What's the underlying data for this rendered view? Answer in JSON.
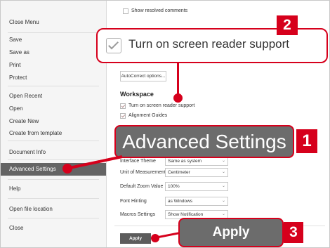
{
  "menu": {
    "items": [
      {
        "label": "Close Menu"
      },
      {
        "label": "Save"
      },
      {
        "label": "Save as"
      },
      {
        "label": "Print"
      },
      {
        "label": "Protect"
      },
      {
        "label": "Open Recent"
      },
      {
        "label": "Open"
      },
      {
        "label": "Create New"
      },
      {
        "label": "Create from template"
      },
      {
        "label": "Document Info"
      },
      {
        "label": "Advanced Settings"
      },
      {
        "label": "Help"
      },
      {
        "label": "Open file location"
      },
      {
        "label": "Close"
      }
    ]
  },
  "settings": {
    "show_resolved": "Show resolved comments",
    "autocorrect_btn": "AutoCorrect options...",
    "workspace_title": "Workspace",
    "screen_reader": "Turn on screen reader support",
    "alignment_guides": "Alignment Guides",
    "interface_theme_label": "Interface Theme",
    "interface_theme_value": "Same as system",
    "unit_label": "Unit of Measurement",
    "unit_value": "Centimeter",
    "zoom_label": "Default Zoom Value",
    "zoom_value": "100%",
    "hinting_label": "Font Hinting",
    "hinting_value": "as Windows",
    "macros_label": "Macros Settings",
    "macros_value": "Show Notification",
    "apply_btn": "Apply"
  },
  "callouts": {
    "c1": {
      "text": "Advanced Settings",
      "badge": "1"
    },
    "c2": {
      "text": "Turn on screen reader support",
      "badge": "2"
    },
    "c3": {
      "text": "Apply",
      "badge": "3"
    }
  },
  "colors": {
    "accent": "#d6001c",
    "active_menu": "#646464",
    "callout_bar": "#6c6c6c"
  }
}
